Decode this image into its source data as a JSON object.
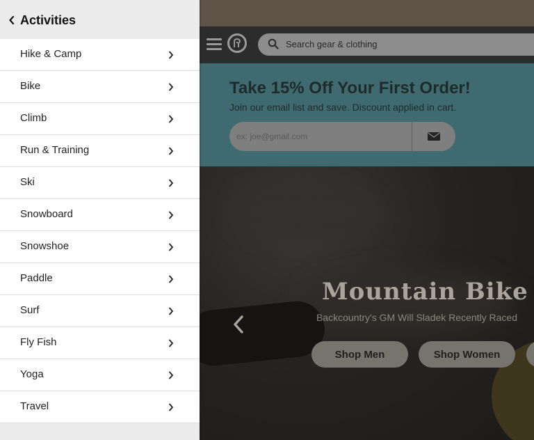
{
  "drawer": {
    "title": "Activities",
    "items": [
      {
        "label": "Hike & Camp"
      },
      {
        "label": "Bike"
      },
      {
        "label": "Climb"
      },
      {
        "label": "Run & Training"
      },
      {
        "label": "Ski"
      },
      {
        "label": "Snowboard"
      },
      {
        "label": "Snowshoe"
      },
      {
        "label": "Paddle"
      },
      {
        "label": "Surf"
      },
      {
        "label": "Fly Fish"
      },
      {
        "label": "Yoga"
      },
      {
        "label": "Travel"
      }
    ]
  },
  "header": {
    "search_placeholder": "Search gear & clothing",
    "icons": [
      "menu-icon",
      "logo-icon",
      "search-icon"
    ]
  },
  "signup": {
    "title": "Take 15% Off Your First Order!",
    "subtitle": "Join our email list and save. Discount applied in cart.",
    "email_placeholder": "ex: joe@gmail.com",
    "submit_icon": "envelope-icon"
  },
  "hero": {
    "title": "Mountain Bike A",
    "subtitle": "Backcountry's GM Will Sladek Recently Raced",
    "buttons": {
      "men": "Shop Men",
      "women": "Shop Women"
    }
  },
  "colors": {
    "drawer_bg": "#ececec",
    "item_bg": "#ffffff",
    "signup_bg": "#3f6a6f",
    "overlay_dark": "#1e1c1a"
  }
}
